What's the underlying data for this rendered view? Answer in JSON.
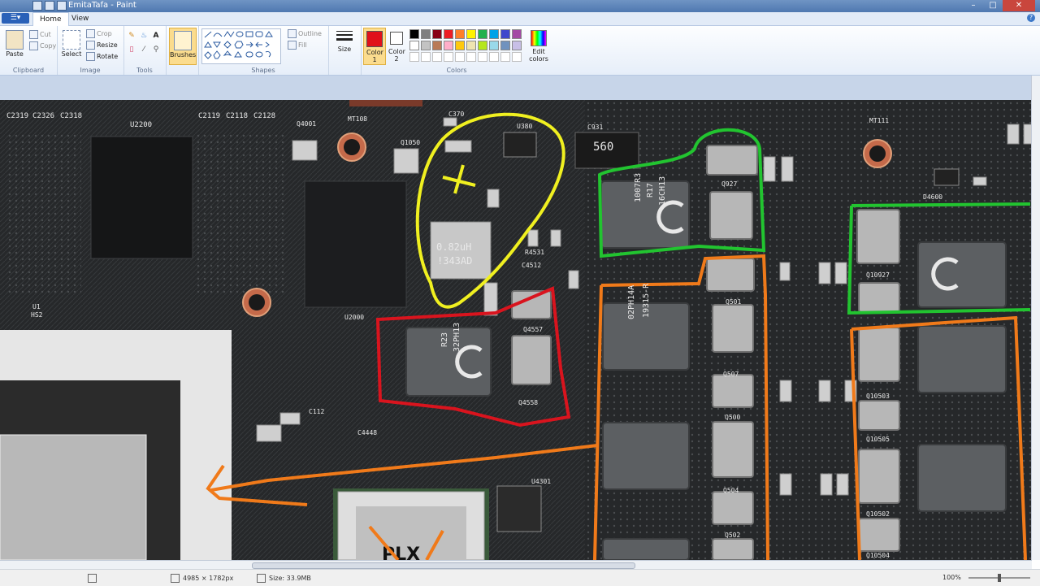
{
  "window": {
    "title": "EmitaTafa - Paint"
  },
  "tabs": {
    "file": "",
    "home": "Home",
    "view": "View"
  },
  "ribbon": {
    "clipboard": {
      "paste": "Paste",
      "cut": "Cut",
      "copy": "Copy",
      "label": "Clipboard"
    },
    "image": {
      "select": "Select",
      "crop": "Crop",
      "resize": "Resize",
      "rotate": "Rotate",
      "label": "Image"
    },
    "tools": {
      "label": "Tools",
      "text_tool": "A"
    },
    "brushes": {
      "label": "Brushes"
    },
    "shapes": {
      "outline": "Outline",
      "fill": "Fill",
      "label": "Shapes"
    },
    "size": {
      "label": "Size"
    },
    "colors": {
      "color1": "Color 1",
      "color2": "Color 2",
      "edit": "Edit colors",
      "label": "Colors",
      "color1_value": "#e0101a",
      "color2_value": "#ffffff",
      "palette": [
        "#000000",
        "#7f7f7f",
        "#880015",
        "#ed1c24",
        "#ff7f27",
        "#fff200",
        "#22b14c",
        "#00a2e8",
        "#3f48cc",
        "#a349a4",
        "#ffffff",
        "#c3c3c3",
        "#b97a57",
        "#ffaec9",
        "#ffc90e",
        "#efe4b0",
        "#b5e61d",
        "#99d9ea",
        "#7092be",
        "#c8bfe7"
      ]
    }
  },
  "canvas": {
    "labels": {
      "c2319": "C2319",
      "c2326": "C2326",
      "c2318": "C2318",
      "u2200": "U2200",
      "c2119": "C2119",
      "c2118": "C2118",
      "c2128": "C2128",
      "q4001": "Q4001",
      "mt108": "MT108",
      "c370": "C370",
      "u380": "U380",
      "q1050": "Q1050",
      "c931": "C931",
      "cap560": "560",
      "mt111": "MT111",
      "u1": "U1",
      "hs2": "HS2",
      "u2000": "U2000",
      "ind_082": "0.82uH",
      "ind_343": "!343AD",
      "r4531": "R4531",
      "c4512": "C4512",
      "q927": "Q927",
      "q4557": "Q4557",
      "q4558": "Q4558",
      "q501": "Q501",
      "q507": "Q507",
      "q500": "Q500",
      "q504": "Q504",
      "q502": "Q502",
      "q10927": "Q10927",
      "q10503": "Q10503",
      "q10505": "Q10505",
      "q10502": "Q10502",
      "q10504": "Q10504",
      "d4600": "D4600",
      "u4301": "U4301",
      "c4448": "C4448",
      "c112": "C112",
      "chip_1007": "1007R3",
      "chip_r17": "R17",
      "chip_16ch13": "16CH13",
      "chip_r23": "R23",
      "chip_32ph": "32PH13",
      "ind_19315": "19315-R",
      "ind_02ph": "02PH14A"
    }
  },
  "status": {
    "dimensions": "4985 × 1782px",
    "size": "Size: 33.9MB",
    "zoom": "100%"
  }
}
